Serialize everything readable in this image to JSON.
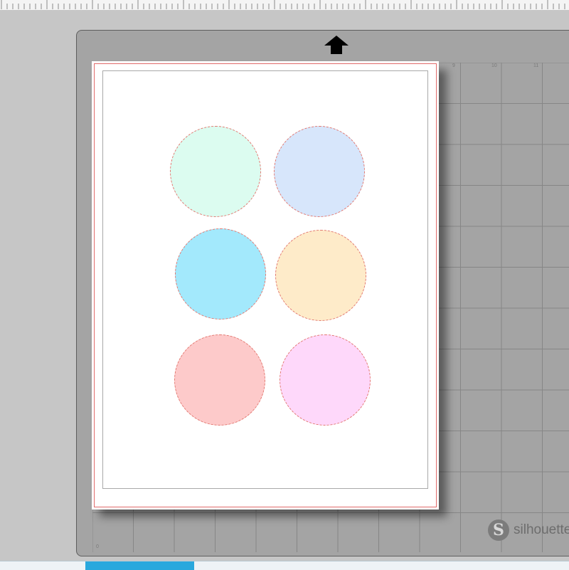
{
  "app": {
    "accent": "#29a8dd",
    "mat_color": "#a4a4a4"
  },
  "mat": {
    "brand": "silhouette",
    "brand_mark": "S",
    "column_numbers": [
      "9",
      "10",
      "11"
    ],
    "corner_number": "0",
    "feed_arrow_icon": "feed-up-arrow-icon"
  },
  "page": {
    "cut_border_color": "#e06a6a"
  },
  "shapes": [
    {
      "name": "circle-mint",
      "fill": "#dcfcf0"
    },
    {
      "name": "circle-light-blue",
      "fill": "#d7e6fb"
    },
    {
      "name": "circle-cyan",
      "fill": "#a3e9fc"
    },
    {
      "name": "circle-peach",
      "fill": "#feebc9"
    },
    {
      "name": "circle-salmon",
      "fill": "#fdcaca"
    },
    {
      "name": "circle-pink",
      "fill": "#fed8fa"
    }
  ]
}
